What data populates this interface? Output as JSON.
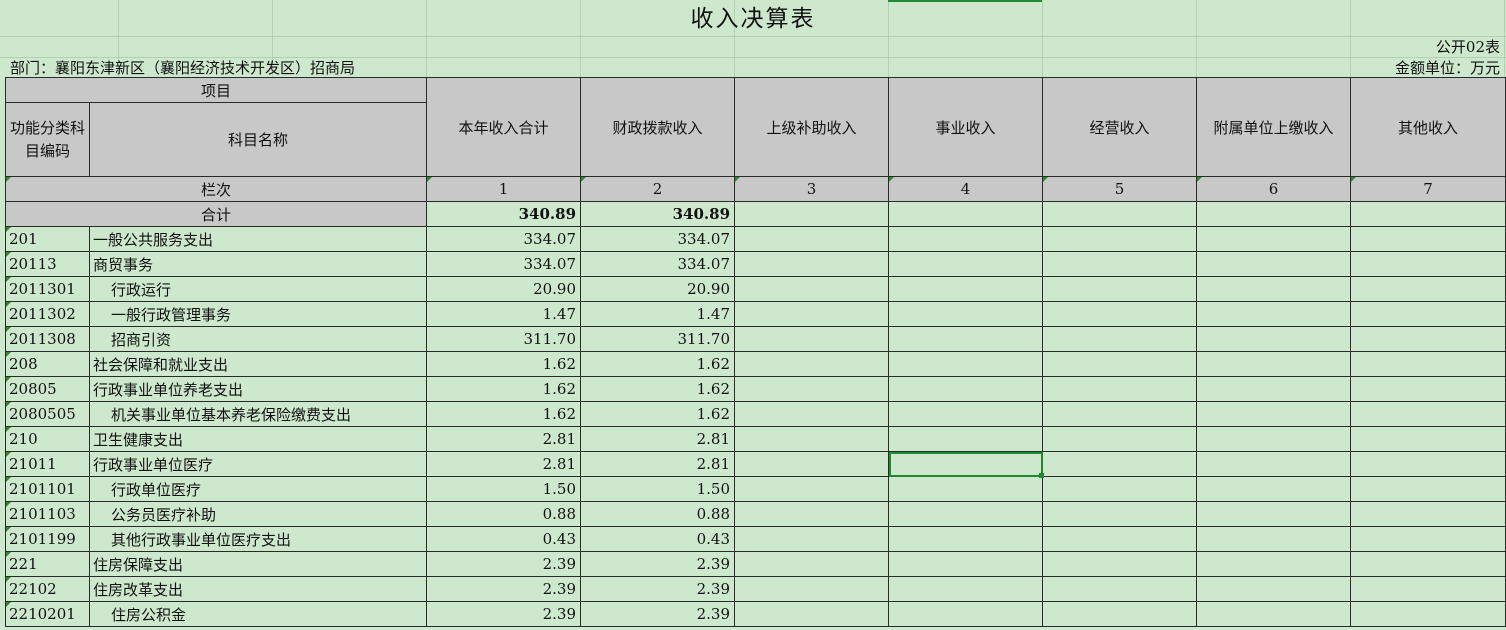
{
  "title": "收入决算表",
  "table_no": "公开02表",
  "department": "部门：襄阳东津新区（襄阳经济技术开发区）招商局",
  "unit": "金额单位：万元",
  "header": {
    "project": "项目",
    "code": "功能分类科目编码",
    "name": "科目名称",
    "columns": [
      "本年收入合计",
      "财政拨款收入",
      "上级补助收入",
      "事业收入",
      "经营收入",
      "附属单位上缴收入",
      "其他收入"
    ],
    "lanci": "栏次",
    "col_numbers": [
      "1",
      "2",
      "3",
      "4",
      "5",
      "6",
      "7"
    ]
  },
  "total": {
    "label": "合计",
    "values": [
      "340.89",
      "340.89",
      "",
      "",
      "",
      "",
      ""
    ]
  },
  "rows": [
    {
      "code": "201",
      "name": "一般公共服务支出",
      "indent": false,
      "values": [
        "334.07",
        "334.07",
        "",
        "",
        "",
        "",
        ""
      ]
    },
    {
      "code": "20113",
      "name": "商贸事务",
      "indent": false,
      "values": [
        "334.07",
        "334.07",
        "",
        "",
        "",
        "",
        ""
      ]
    },
    {
      "code": "2011301",
      "name": "行政运行",
      "indent": true,
      "values": [
        "20.90",
        "20.90",
        "",
        "",
        "",
        "",
        ""
      ]
    },
    {
      "code": "2011302",
      "name": "一般行政管理事务",
      "indent": true,
      "values": [
        "1.47",
        "1.47",
        "",
        "",
        "",
        "",
        ""
      ]
    },
    {
      "code": "2011308",
      "name": "招商引资",
      "indent": true,
      "values": [
        "311.70",
        "311.70",
        "",
        "",
        "",
        "",
        ""
      ]
    },
    {
      "code": "208",
      "name": "社会保障和就业支出",
      "indent": false,
      "values": [
        "1.62",
        "1.62",
        "",
        "",
        "",
        "",
        ""
      ]
    },
    {
      "code": "20805",
      "name": "行政事业单位养老支出",
      "indent": false,
      "values": [
        "1.62",
        "1.62",
        "",
        "",
        "",
        "",
        ""
      ]
    },
    {
      "code": "2080505",
      "name": "机关事业单位基本养老保险缴费支出",
      "indent": true,
      "values": [
        "1.62",
        "1.62",
        "",
        "",
        "",
        "",
        ""
      ]
    },
    {
      "code": "210",
      "name": "卫生健康支出",
      "indent": false,
      "values": [
        "2.81",
        "2.81",
        "",
        "",
        "",
        "",
        ""
      ]
    },
    {
      "code": "21011",
      "name": "行政事业单位医疗",
      "indent": false,
      "values": [
        "2.81",
        "2.81",
        "",
        "",
        "",
        "",
        ""
      ]
    },
    {
      "code": "2101101",
      "name": "行政单位医疗",
      "indent": true,
      "values": [
        "1.50",
        "1.50",
        "",
        "",
        "",
        "",
        ""
      ]
    },
    {
      "code": "2101103",
      "name": "公务员医疗补助",
      "indent": true,
      "values": [
        "0.88",
        "0.88",
        "",
        "",
        "",
        "",
        ""
      ]
    },
    {
      "code": "2101199",
      "name": "其他行政事业单位医疗支出",
      "indent": true,
      "values": [
        "0.43",
        "0.43",
        "",
        "",
        "",
        "",
        ""
      ]
    },
    {
      "code": "221",
      "name": "住房保障支出",
      "indent": false,
      "values": [
        "2.39",
        "2.39",
        "",
        "",
        "",
        "",
        ""
      ]
    },
    {
      "code": "22102",
      "name": "住房改革支出",
      "indent": false,
      "values": [
        "2.39",
        "2.39",
        "",
        "",
        "",
        "",
        ""
      ]
    },
    {
      "code": "2210201",
      "name": "住房公积金",
      "indent": true,
      "values": [
        "2.39",
        "2.39",
        "",
        "",
        "",
        "",
        ""
      ]
    }
  ],
  "colors": {
    "sheet_bg": "#cde8cd",
    "header_bg": "#c8c8c8",
    "selection": "#1f8a2f"
  }
}
